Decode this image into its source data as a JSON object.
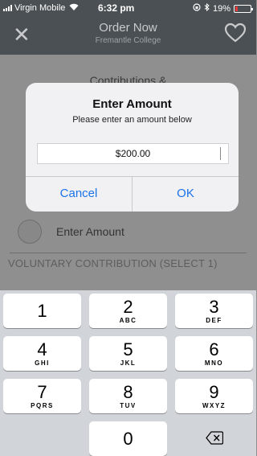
{
  "status_bar": {
    "carrier": "Virgin Mobile",
    "time": "6:32 pm",
    "battery": "19%",
    "battery_level": 0.19,
    "battery_color": "#e23a3a"
  },
  "nav": {
    "title": "Order Now",
    "subtitle": "Fremantle College",
    "close_icon": "close-icon",
    "favorite_icon": "heart-outline-icon"
  },
  "page": {
    "contributions_heading": "Contributions &",
    "enter_amount_option": "Enter Amount",
    "voluntary_heading": "VOLUNTARY CONTRIBUTION (SELECT 1)"
  },
  "alert": {
    "title": "Enter Amount",
    "message": "Please enter an amount below",
    "input_value": "$200.00",
    "cancel_label": "Cancel",
    "ok_label": "OK",
    "accent": "#1a73e8"
  },
  "keypad": {
    "keys": [
      {
        "num": "1",
        "letters": ""
      },
      {
        "num": "2",
        "letters": "ABC"
      },
      {
        "num": "3",
        "letters": "DEF"
      },
      {
        "num": "4",
        "letters": "GHI"
      },
      {
        "num": "5",
        "letters": "JKL"
      },
      {
        "num": "6",
        "letters": "MNO"
      },
      {
        "num": "7",
        "letters": "PQRS"
      },
      {
        "num": "8",
        "letters": "TUV"
      },
      {
        "num": "9",
        "letters": "WXYZ"
      },
      {
        "num": "0",
        "letters": ""
      }
    ],
    "backspace_icon": "backspace-icon"
  }
}
